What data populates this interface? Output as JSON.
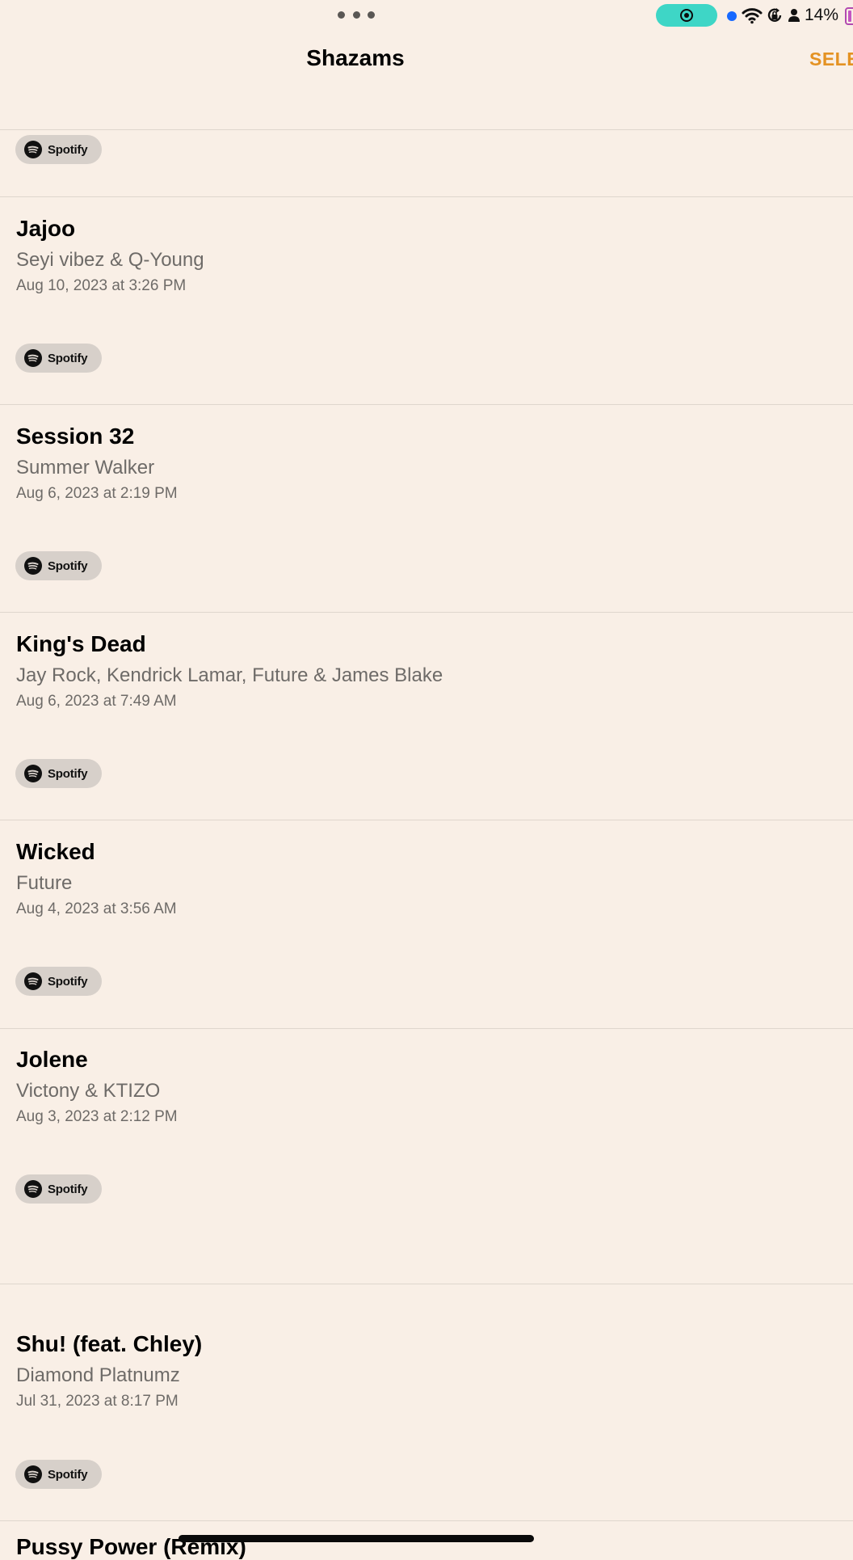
{
  "status_bar": {
    "battery_percent": "14%",
    "icons": [
      "more-dots-icon",
      "screen-record-icon",
      "camera-indicator-dot",
      "wifi-icon",
      "orientation-lock-icon",
      "person-icon",
      "battery-icon"
    ],
    "record_color": "#3ed6c6"
  },
  "nav": {
    "title": "Shazams",
    "select_label": "SELE",
    "accent_color": "#e49223"
  },
  "spotify_label": "Spotify",
  "songs": [
    {
      "title": "Jajoo",
      "artist": "Seyi vibez & Q-Young",
      "date": "Aug 10, 2023 at 3:26 PM"
    },
    {
      "title": "Session 32",
      "artist": "Summer Walker",
      "date": "Aug 6, 2023 at 2:19 PM"
    },
    {
      "title": "King's Dead",
      "artist": "Jay Rock, Kendrick Lamar, Future & James Blake",
      "date": "Aug 6, 2023 at 7:49 AM"
    },
    {
      "title": "Wicked",
      "artist": "Future",
      "date": "Aug 4, 2023 at 3:56 AM"
    },
    {
      "title": "Jolene",
      "artist": "Victony & KTIZO",
      "date": "Aug 3, 2023 at 2:12 PM"
    },
    {
      "title": "Shu! (feat. Chley)",
      "artist": "Diamond Platnumz",
      "date": "Jul 31, 2023 at 8:17 PM"
    }
  ],
  "partial_next_title": "Pussy Power (Remix)"
}
